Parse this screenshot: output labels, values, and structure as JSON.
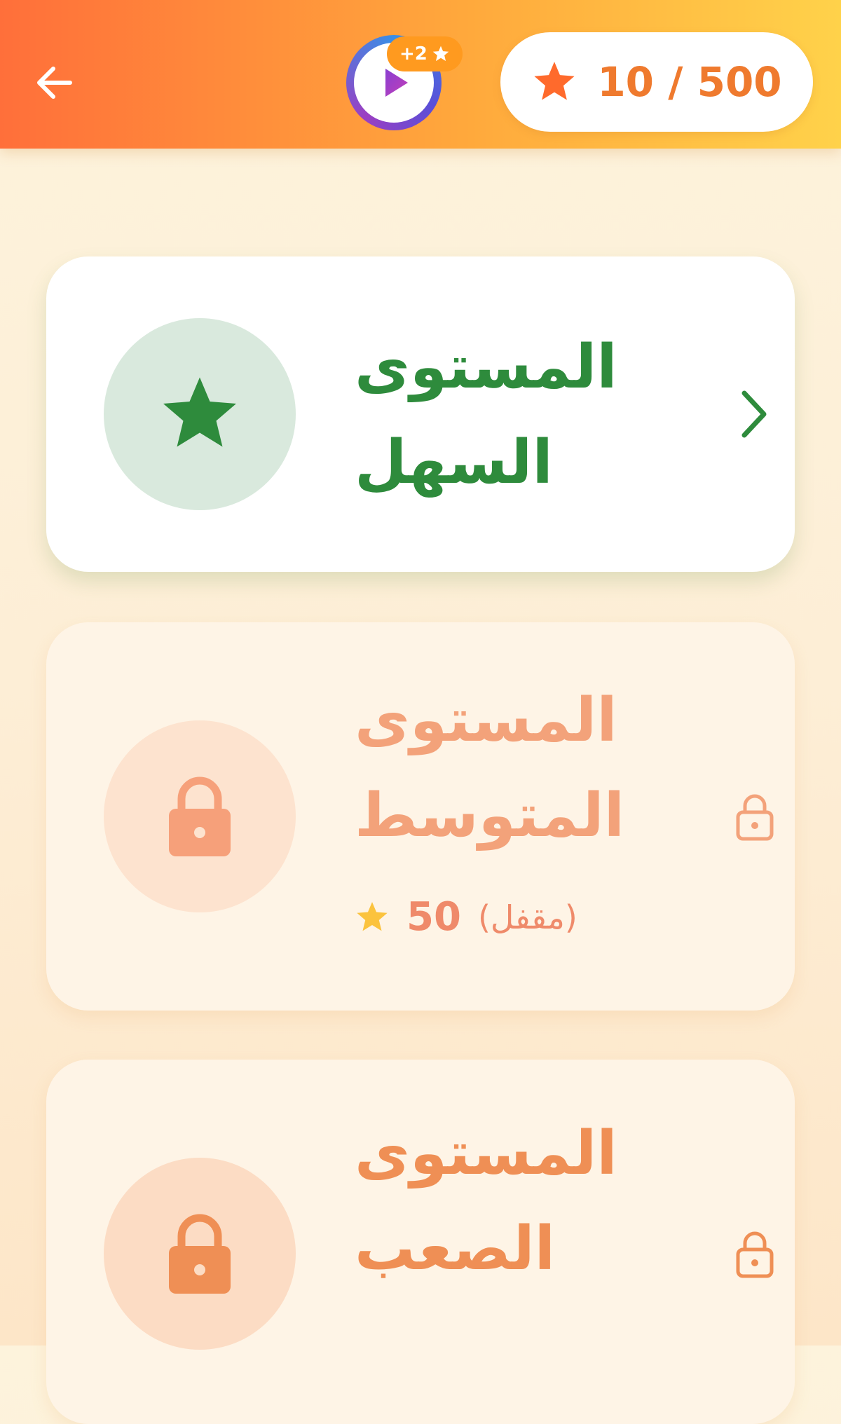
{
  "header": {
    "back_icon": "arrow-left-icon",
    "video_reward": {
      "icon": "play-video-icon",
      "badge_text": "+2",
      "badge_icon": "star-icon"
    },
    "score": {
      "icon": "star-icon",
      "text": "10 / 500",
      "icon_color": "#ff6a2c"
    }
  },
  "levels": [
    {
      "title_line1": "المستوى",
      "title_line2": "السهل",
      "state": "unlocked",
      "icon": "star-icon",
      "action_icon": "chevron-right-icon",
      "color": "#2e8b3c"
    },
    {
      "title_line1": "المستوى",
      "title_line2": "المتوسط",
      "state": "locked",
      "icon": "padlock-icon",
      "action_icon": "padlock-icon",
      "status_text": "(مقفل)",
      "cost": "50",
      "cost_icon": "star-icon",
      "color": "#f3a27a"
    },
    {
      "title_line1": "المستوى",
      "title_line2": "الصعب",
      "state": "locked",
      "icon": "padlock-icon",
      "action_icon": "padlock-icon",
      "color": "#ef8f55"
    }
  ]
}
